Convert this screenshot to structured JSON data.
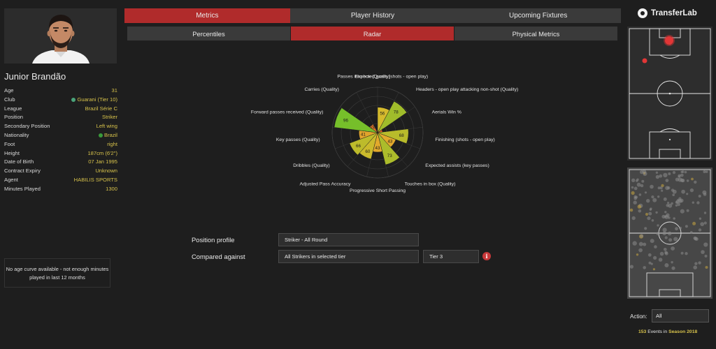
{
  "player": {
    "name": "Junior Brandão",
    "fields": [
      {
        "label": "Age",
        "value": "31"
      },
      {
        "label": "Club",
        "value": "Guarani (Tier 10)",
        "badge_color": "#4aa37a"
      },
      {
        "label": "League",
        "value": "Brazil Série C"
      },
      {
        "label": "Position",
        "value": "Striker"
      },
      {
        "label": "Secondary Position",
        "value": "Left wing"
      },
      {
        "label": "Nationality",
        "value": "Brazil",
        "badge_color": "#3a9a3a"
      },
      {
        "label": "Foot",
        "value": "right"
      },
      {
        "label": "Height",
        "value": "187cm (6'2\")"
      },
      {
        "label": "Date of Birth",
        "value": "07 Jan 1995"
      },
      {
        "label": "Contract Expiry",
        "value": "Unknown"
      },
      {
        "label": "Agent",
        "value": "HABILIS SPORTS"
      },
      {
        "label": "Minutes Played",
        "value": "1300"
      }
    ],
    "age_curve_note": "No age curve available - not enough minutes played in last 12 months"
  },
  "tabs_primary": [
    {
      "label": "Metrics",
      "active": true
    },
    {
      "label": "Player History",
      "active": false
    },
    {
      "label": "Upcoming Fixtures",
      "active": false
    }
  ],
  "tabs_secondary": [
    {
      "label": "Percentiles",
      "active": false
    },
    {
      "label": "Radar",
      "active": true
    },
    {
      "label": "Physical Metrics",
      "active": false
    }
  ],
  "chart_data": {
    "type": "radar",
    "max": 100,
    "rings": [
      20,
      40,
      60,
      80,
      100
    ],
    "metrics": [
      {
        "name": "Expected goals (shots - open play)",
        "value": 56
      },
      {
        "name": "Headers - open play attacking non-shot (Quality)",
        "value": 78
      },
      {
        "name": "Aerials Win %",
        "value": 11
      },
      {
        "name": "Finishing (shots - open play)",
        "value": 68
      },
      {
        "name": "Expected assists (key passes)",
        "value": 43
      },
      {
        "name": "Touches in box (Quality)",
        "value": 73
      },
      {
        "name": "Progressive Short Passing",
        "value": 43
      },
      {
        "name": "Adjusted Pass Accuracy",
        "value": 60
      },
      {
        "name": "Dribbles (Quality)",
        "value": 66
      },
      {
        "name": "Key passes (Quality)",
        "value": 41
      },
      {
        "name": "Forward passes received (Quality)",
        "value": 96
      },
      {
        "name": "Carries (Quality)",
        "value": 21
      },
      {
        "name": "Passes into box (Quality)",
        "value": 1
      }
    ],
    "color_scale": {
      "low": "#d9442b",
      "mid": "#e3b92c",
      "high": "#6cbf2a"
    }
  },
  "form": {
    "position_profile_label": "Position profile",
    "position_profile_value": "Striker - All Round",
    "compared_against_label": "Compared against",
    "compared_against_value": "All Strikers in selected tier",
    "tier_value": "Tier 3",
    "info_icon_glyph": "i"
  },
  "right": {
    "logo_text": "TransferLab",
    "action_label": "Action:",
    "action_value": "All",
    "events_count": "153",
    "events_middle": " Events in ",
    "events_season": "Season 2018"
  },
  "icons": {
    "info": "info-icon",
    "logo": "transferlab-logo-icon"
  }
}
